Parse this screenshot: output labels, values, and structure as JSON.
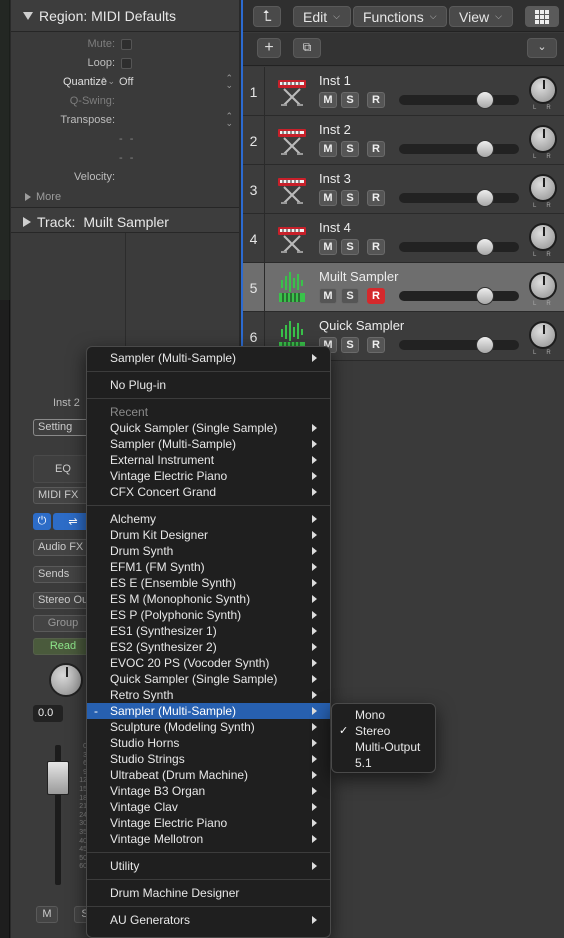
{
  "inspector": {
    "region_header": "Region: MIDI Defaults",
    "params": {
      "mute": "Mute:",
      "loop": "Loop:",
      "quantize_label": "Quantize",
      "quantize_value": "Off",
      "q_swing": "Q-Swing:",
      "transpose": "Transpose:",
      "dashes1": "- -",
      "dashes2": "- -",
      "velocity": "Velocity:"
    },
    "more": "More",
    "track_header_prefix": "Track:",
    "track_header_name": "Muilt Sampler"
  },
  "channel_strip": {
    "name": "Inst 2",
    "setting": "Setting",
    "eq": "EQ",
    "midi_fx": "MIDI FX",
    "audio_fx": "Audio FX",
    "sends": "Sends",
    "stereo_out": "Stereo Out",
    "group": "Group",
    "read": "Read",
    "volume": "0.0",
    "mute": "M",
    "solo": "S",
    "meter_scale": [
      "0",
      "3",
      "6",
      "9",
      "12",
      "15",
      "18",
      "21",
      "24",
      "30",
      "35",
      "40",
      "45",
      "50",
      "60"
    ]
  },
  "toolbar": {
    "edit": "Edit",
    "functions": "Functions",
    "view": "View"
  },
  "tracks": [
    {
      "num": "1",
      "name": "Inst 1",
      "icon": "keyboard-icon",
      "mute": "M",
      "solo": "S",
      "record": "R",
      "rec_armed": false,
      "volume": 0.72,
      "selected": false
    },
    {
      "num": "2",
      "name": "Inst 2",
      "icon": "keyboard-icon",
      "mute": "M",
      "solo": "S",
      "record": "R",
      "rec_armed": false,
      "volume": 0.72,
      "selected": false
    },
    {
      "num": "3",
      "name": "Inst 3",
      "icon": "keyboard-icon",
      "mute": "M",
      "solo": "S",
      "record": "R",
      "rec_armed": false,
      "volume": 0.72,
      "selected": false
    },
    {
      "num": "4",
      "name": "Inst 4",
      "icon": "keyboard-icon",
      "mute": "M",
      "solo": "S",
      "record": "R",
      "rec_armed": false,
      "volume": 0.72,
      "selected": false
    },
    {
      "num": "5",
      "name": "Muilt Sampler",
      "icon": "sampler-icon",
      "mute": "M",
      "solo": "S",
      "record": "R",
      "rec_armed": true,
      "volume": 0.72,
      "selected": true
    },
    {
      "num": "6",
      "name": "Quick Sampler",
      "icon": "sampler-icon",
      "mute": "M",
      "solo": "S",
      "record": "R",
      "rec_armed": false,
      "volume": 0.72,
      "selected": false
    }
  ],
  "plugin_menu": {
    "top_item": "Sampler (Multi-Sample)",
    "no_plugin": "No Plug-in",
    "recent_header": "Recent",
    "recent": [
      "Quick Sampler (Single Sample)",
      "Sampler (Multi-Sample)",
      "External Instrument",
      "Vintage Electric Piano",
      "CFX Concert Grand"
    ],
    "instruments": [
      "Alchemy",
      "Drum Kit Designer",
      "Drum Synth",
      "EFM1  (FM Synth)",
      "ES E  (Ensemble Synth)",
      "ES M  (Monophonic Synth)",
      "ES P  (Polyphonic Synth)",
      "ES1  (Synthesizer 1)",
      "ES2  (Synthesizer 2)",
      "EVOC 20 PS  (Vocoder Synth)",
      "Quick Sampler (Single Sample)",
      "Retro Synth",
      "Sampler (Multi-Sample)",
      "Sculpture  (Modeling Synth)",
      "Studio Horns",
      "Studio Strings",
      "Ultrabeat (Drum Machine)",
      "Vintage B3 Organ",
      "Vintage Clav",
      "Vintage Electric Piano",
      "Vintage Mellotron"
    ],
    "current_mark": "-",
    "utility": "Utility",
    "drum_machine_designer": "Drum Machine Designer",
    "au_generators": "AU Generators"
  },
  "submenu": {
    "items": [
      "Mono",
      "Stereo",
      "Multi-Output",
      "5.1"
    ],
    "checked_index": 1,
    "check_mark": "✓"
  },
  "colors": {
    "accent_blue": "#2760b0",
    "record_red": "#d5292c",
    "read_green": "#8ee68a",
    "sampler_green": "#39c24a"
  }
}
